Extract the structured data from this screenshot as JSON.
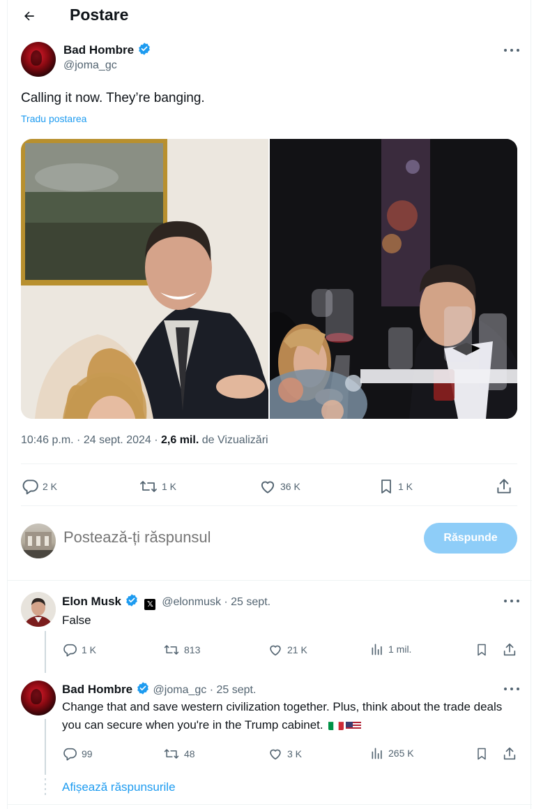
{
  "header": {
    "title": "Postare"
  },
  "tweet": {
    "author_name": "Bad Hombre",
    "author_handle": "@joma_gc",
    "text": "Calling it now. They’re banging.",
    "translate_label": "Tradu postarea",
    "time": "10:46 p.m. · 24 sept. 2024 · ",
    "views_count": "2,6 mil.",
    "views_label": " de Vizualizări",
    "replies": "2 K",
    "reposts": "1 K",
    "likes": "36 K",
    "bookmarks": "1 K"
  },
  "reply_box": {
    "placeholder": "Postează-ți răspunsul",
    "button_label": "Răspunde"
  },
  "replies": [
    {
      "name": "Elon Musk",
      "handle": "@elonmusk",
      "date": " · 25 sept.",
      "text": "False",
      "replies": "1 K",
      "reposts": "813",
      "likes": "21 K",
      "views": "1 mil."
    },
    {
      "name": "Bad Hombre",
      "handle": "@joma_gc",
      "date": " · 25 sept.",
      "text": "Change that and save western civilization together. Plus, think about the trade deals you can secure when you're in the Trump cabinet.",
      "replies": "99",
      "reposts": "48",
      "likes": "3 K",
      "views": "265 K"
    }
  ],
  "show_replies_label": "Afișează răspunsurile",
  "colors": {
    "accent": "#1d9bf0",
    "secondary_text": "#536471",
    "disabled_button": "#8ecdf8"
  },
  "icons": [
    "back-arrow-icon",
    "verified-badge-icon",
    "more-icon",
    "reply-icon",
    "repost-icon",
    "like-icon",
    "bookmark-icon",
    "share-icon",
    "views-icon",
    "x-logo-icon",
    "flag-italy-icon",
    "flag-usa-icon"
  ]
}
